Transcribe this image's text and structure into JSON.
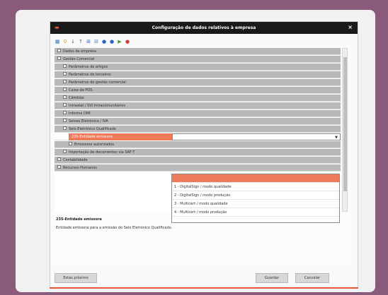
{
  "dialog": {
    "title": "Configuração de dados relativos à empresa",
    "close_label": "×"
  },
  "tree": {
    "rows": [
      {
        "label": "Dados da empresa",
        "level": 0
      },
      {
        "label": "Gestão Comercial",
        "level": 0
      },
      {
        "label": "Parâmetros de artigos",
        "level": 1
      },
      {
        "label": "Parâmetros de terceiros",
        "level": 1
      },
      {
        "label": "Parâmetros do gestão comercial",
        "level": 1
      },
      {
        "label": "Caixa de POS",
        "level": 1
      },
      {
        "label": "Câmbios",
        "level": 1
      },
      {
        "label": "Intrastat / SVI Intracomunitários",
        "level": 1
      },
      {
        "label": "Informe DIM",
        "level": 1
      },
      {
        "label": "Selves Eletrónica / IVA",
        "level": 1
      },
      {
        "label": "Selo Eletrónico Qualificado",
        "level": 1
      }
    ],
    "selected_row": {
      "label": "235-Entidade emissora",
      "combo_value": ""
    },
    "rows_after": [
      {
        "label": "Emissores autorizados",
        "level": 2
      },
      {
        "label": "Importação de documentos via SAF-T",
        "level": 1
      },
      {
        "label": "Contabilidade",
        "level": 0
      },
      {
        "label": "Recursos Humanos",
        "level": 0
      }
    ]
  },
  "dropdown": {
    "options": [
      "",
      "1 - DigitalSign / modo qualidade",
      "2 - DigitalSign / modo produção",
      "3 - Multicert / modo qualidade",
      "4 - Multicert / modo produção"
    ],
    "highlighted_index": 0
  },
  "description": {
    "title": "235-Entidade emissora",
    "text": "Entidade emissora para a emissão do Selo Eletrónico Qualificado."
  },
  "buttons": {
    "left": "Estas próximo",
    "ok": "Guardar",
    "cancel": "Cancelar"
  }
}
